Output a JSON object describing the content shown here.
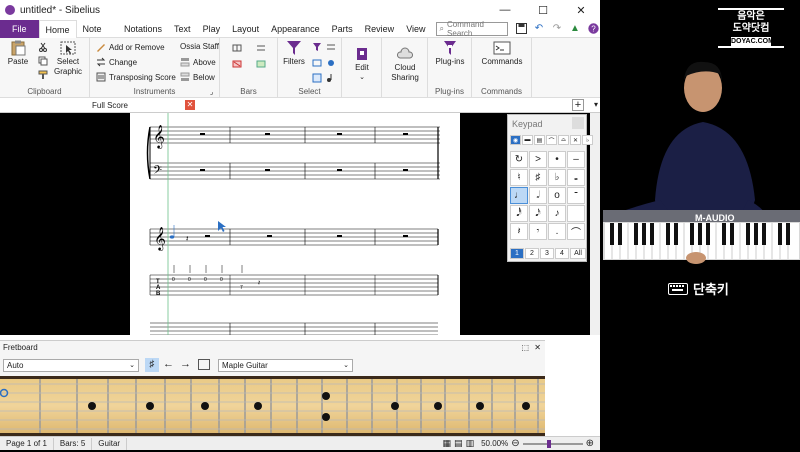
{
  "window": {
    "title": "untitled* - Sibelius"
  },
  "tabs": [
    "File",
    "Home",
    "Note Input",
    "Notations",
    "Text",
    "Play",
    "Layout",
    "Appearance",
    "Parts",
    "Review",
    "View"
  ],
  "search": {
    "placeholder": "Command Search"
  },
  "ribbon": {
    "clipboard": {
      "label": "Clipboard",
      "paste": "Paste",
      "select_graphic": "Select Graphic"
    },
    "instruments": {
      "label": "Instruments",
      "add_remove": "Add or Remove",
      "change": "Change",
      "transposing": "Transposing Score",
      "ossia": "Ossia Staff",
      "above": "Above",
      "below": "Below"
    },
    "bars": {
      "label": "Bars"
    },
    "select": {
      "label": "Select",
      "filters": "Filters"
    },
    "edit": {
      "label": "Edit"
    },
    "cloud": {
      "label": "Cloud Sharing"
    },
    "plugins": {
      "label": "Plug-ins",
      "button": "Plug-ins"
    },
    "commands": {
      "label": "Commands",
      "button": "Commands"
    }
  },
  "document": {
    "tab": "Full Score"
  },
  "keypad": {
    "title": "Keypad",
    "pages": [
      "1",
      "2",
      "3",
      "4",
      "All"
    ]
  },
  "fretboard": {
    "title": "Fretboard",
    "mode": "Auto",
    "instrument": "Maple Guitar"
  },
  "status": {
    "page": "Page 1 of 1",
    "bars": "Bars: 5",
    "instrument": "Guitar",
    "zoom": "50.00%"
  },
  "overlay": {
    "logo": "음악은\n도약닷컴",
    "logo_sub": "DOYAC.COM",
    "shortcut": "단축키",
    "keyboard_brand": "M-AUDIO"
  },
  "colors": {
    "file_tab": "#6b2c8f",
    "accent": "#2b6fc3"
  }
}
